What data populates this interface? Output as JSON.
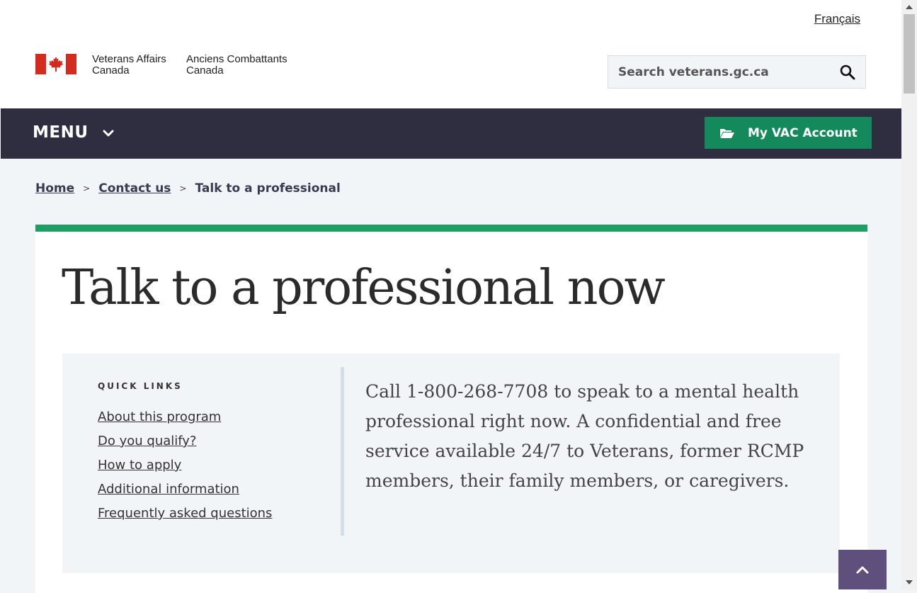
{
  "header": {
    "language_link": "Français",
    "signature_en": [
      "Veterans Affairs",
      "Canada"
    ],
    "signature_fr": [
      "Anciens Combattants",
      "Canada"
    ],
    "search_placeholder": "Search veterans.gc.ca"
  },
  "nav": {
    "menu_label": "MENU",
    "account_button": "My VAC Account"
  },
  "breadcrumb": [
    "Home",
    "Contact us",
    "Talk to a professional"
  ],
  "page": {
    "title": "Talk to a professional now",
    "quick_links_title": "QUICK LINKS",
    "quick_links": [
      "About this program",
      "Do you qualify?",
      "How to apply",
      "Additional information",
      "Frequently asked questions"
    ],
    "lead": "Call 1-800-268-7708 to speak to a mental health professional right now. A confidential and free service available 24/7 to Veterans, former RCMP members, their family members, or caregivers."
  },
  "icons": [
    "canada-flag-icon",
    "search-icon",
    "chevron-down-icon",
    "folder-open-icon",
    "chevron-up-icon"
  ],
  "colors": {
    "nav_bg": "#2e2e40",
    "accent_green": "#148a5c",
    "card_top_border": "#1f9e64",
    "back_to_top_bg": "#5e4f7c",
    "flag_red": "#d52b1e"
  }
}
